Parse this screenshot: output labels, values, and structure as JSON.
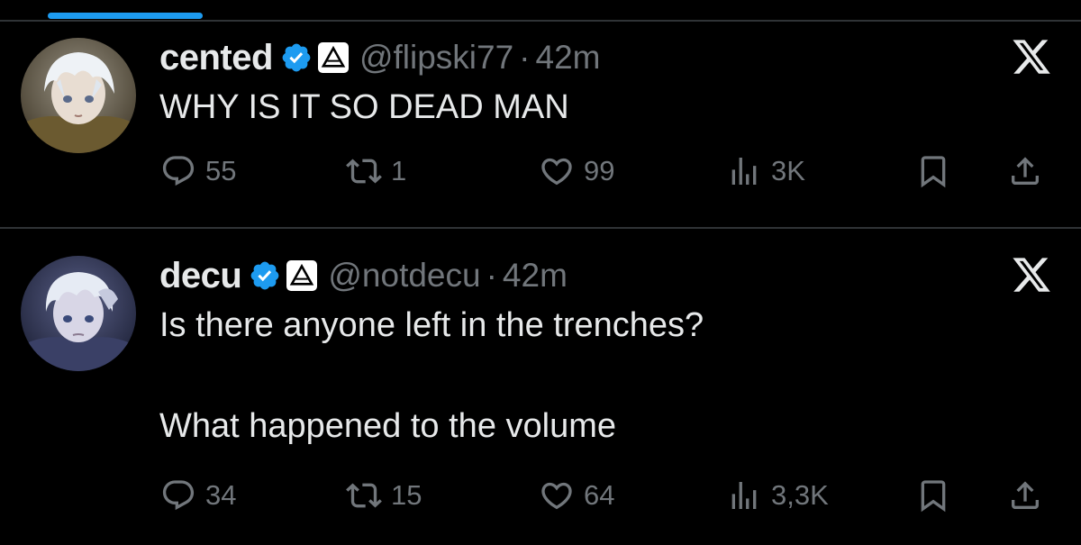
{
  "colors": {
    "background": "#000000",
    "text": "#e7e9ea",
    "muted": "#71767b",
    "accent": "#1d9bf0",
    "divider": "#2f3336"
  },
  "tweets": [
    {
      "display_name": "cented",
      "verified_icon": "verified-badge-icon",
      "affiliate_icon": "triangle-affiliate-icon",
      "handle": "@flipski77",
      "separator": "·",
      "time": "42m",
      "close_icon": "x-logo-icon",
      "text_lines": [
        "WHY IS IT SO DEAD MAN"
      ],
      "stats": {
        "replies": "55",
        "reposts": "1",
        "likes": "99",
        "views": "3K"
      }
    },
    {
      "display_name": "decu",
      "verified_icon": "verified-badge-icon",
      "affiliate_icon": "triangle-affiliate-icon",
      "handle": "@notdecu",
      "separator": "·",
      "time": "42m",
      "close_icon": "x-logo-icon",
      "text_lines": [
        "Is there anyone left in the trenches?",
        "What happened to the volume"
      ],
      "stats": {
        "replies": "34",
        "reposts": "15",
        "likes": "64",
        "views": "3,3K"
      }
    }
  ]
}
